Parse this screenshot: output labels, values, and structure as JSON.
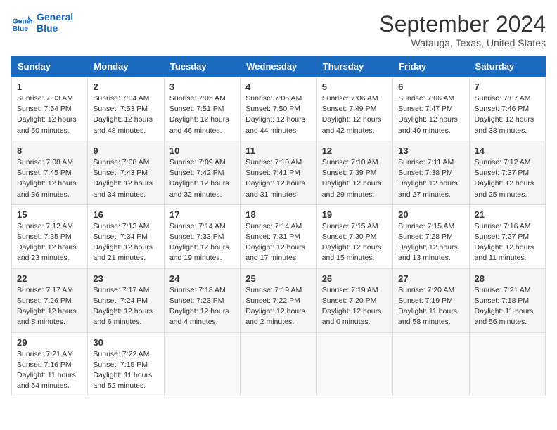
{
  "header": {
    "logo_line1": "General",
    "logo_line2": "Blue",
    "title": "September 2024",
    "subtitle": "Watauga, Texas, United States"
  },
  "columns": [
    "Sunday",
    "Monday",
    "Tuesday",
    "Wednesday",
    "Thursday",
    "Friday",
    "Saturday"
  ],
  "weeks": [
    [
      {
        "day": "1",
        "info": "Sunrise: 7:03 AM\nSunset: 7:54 PM\nDaylight: 12 hours\nand 50 minutes."
      },
      {
        "day": "2",
        "info": "Sunrise: 7:04 AM\nSunset: 7:53 PM\nDaylight: 12 hours\nand 48 minutes."
      },
      {
        "day": "3",
        "info": "Sunrise: 7:05 AM\nSunset: 7:51 PM\nDaylight: 12 hours\nand 46 minutes."
      },
      {
        "day": "4",
        "info": "Sunrise: 7:05 AM\nSunset: 7:50 PM\nDaylight: 12 hours\nand 44 minutes."
      },
      {
        "day": "5",
        "info": "Sunrise: 7:06 AM\nSunset: 7:49 PM\nDaylight: 12 hours\nand 42 minutes."
      },
      {
        "day": "6",
        "info": "Sunrise: 7:06 AM\nSunset: 7:47 PM\nDaylight: 12 hours\nand 40 minutes."
      },
      {
        "day": "7",
        "info": "Sunrise: 7:07 AM\nSunset: 7:46 PM\nDaylight: 12 hours\nand 38 minutes."
      }
    ],
    [
      {
        "day": "8",
        "info": "Sunrise: 7:08 AM\nSunset: 7:45 PM\nDaylight: 12 hours\nand 36 minutes."
      },
      {
        "day": "9",
        "info": "Sunrise: 7:08 AM\nSunset: 7:43 PM\nDaylight: 12 hours\nand 34 minutes."
      },
      {
        "day": "10",
        "info": "Sunrise: 7:09 AM\nSunset: 7:42 PM\nDaylight: 12 hours\nand 32 minutes."
      },
      {
        "day": "11",
        "info": "Sunrise: 7:10 AM\nSunset: 7:41 PM\nDaylight: 12 hours\nand 31 minutes."
      },
      {
        "day": "12",
        "info": "Sunrise: 7:10 AM\nSunset: 7:39 PM\nDaylight: 12 hours\nand 29 minutes."
      },
      {
        "day": "13",
        "info": "Sunrise: 7:11 AM\nSunset: 7:38 PM\nDaylight: 12 hours\nand 27 minutes."
      },
      {
        "day": "14",
        "info": "Sunrise: 7:12 AM\nSunset: 7:37 PM\nDaylight: 12 hours\nand 25 minutes."
      }
    ],
    [
      {
        "day": "15",
        "info": "Sunrise: 7:12 AM\nSunset: 7:35 PM\nDaylight: 12 hours\nand 23 minutes."
      },
      {
        "day": "16",
        "info": "Sunrise: 7:13 AM\nSunset: 7:34 PM\nDaylight: 12 hours\nand 21 minutes."
      },
      {
        "day": "17",
        "info": "Sunrise: 7:14 AM\nSunset: 7:33 PM\nDaylight: 12 hours\nand 19 minutes."
      },
      {
        "day": "18",
        "info": "Sunrise: 7:14 AM\nSunset: 7:31 PM\nDaylight: 12 hours\nand 17 minutes."
      },
      {
        "day": "19",
        "info": "Sunrise: 7:15 AM\nSunset: 7:30 PM\nDaylight: 12 hours\nand 15 minutes."
      },
      {
        "day": "20",
        "info": "Sunrise: 7:15 AM\nSunset: 7:28 PM\nDaylight: 12 hours\nand 13 minutes."
      },
      {
        "day": "21",
        "info": "Sunrise: 7:16 AM\nSunset: 7:27 PM\nDaylight: 12 hours\nand 11 minutes."
      }
    ],
    [
      {
        "day": "22",
        "info": "Sunrise: 7:17 AM\nSunset: 7:26 PM\nDaylight: 12 hours\nand 8 minutes."
      },
      {
        "day": "23",
        "info": "Sunrise: 7:17 AM\nSunset: 7:24 PM\nDaylight: 12 hours\nand 6 minutes."
      },
      {
        "day": "24",
        "info": "Sunrise: 7:18 AM\nSunset: 7:23 PM\nDaylight: 12 hours\nand 4 minutes."
      },
      {
        "day": "25",
        "info": "Sunrise: 7:19 AM\nSunset: 7:22 PM\nDaylight: 12 hours\nand 2 minutes."
      },
      {
        "day": "26",
        "info": "Sunrise: 7:19 AM\nSunset: 7:20 PM\nDaylight: 12 hours\nand 0 minutes."
      },
      {
        "day": "27",
        "info": "Sunrise: 7:20 AM\nSunset: 7:19 PM\nDaylight: 11 hours\nand 58 minutes."
      },
      {
        "day": "28",
        "info": "Sunrise: 7:21 AM\nSunset: 7:18 PM\nDaylight: 11 hours\nand 56 minutes."
      }
    ],
    [
      {
        "day": "29",
        "info": "Sunrise: 7:21 AM\nSunset: 7:16 PM\nDaylight: 11 hours\nand 54 minutes."
      },
      {
        "day": "30",
        "info": "Sunrise: 7:22 AM\nSunset: 7:15 PM\nDaylight: 11 hours\nand 52 minutes."
      },
      {
        "day": "",
        "info": ""
      },
      {
        "day": "",
        "info": ""
      },
      {
        "day": "",
        "info": ""
      },
      {
        "day": "",
        "info": ""
      },
      {
        "day": "",
        "info": ""
      }
    ]
  ]
}
